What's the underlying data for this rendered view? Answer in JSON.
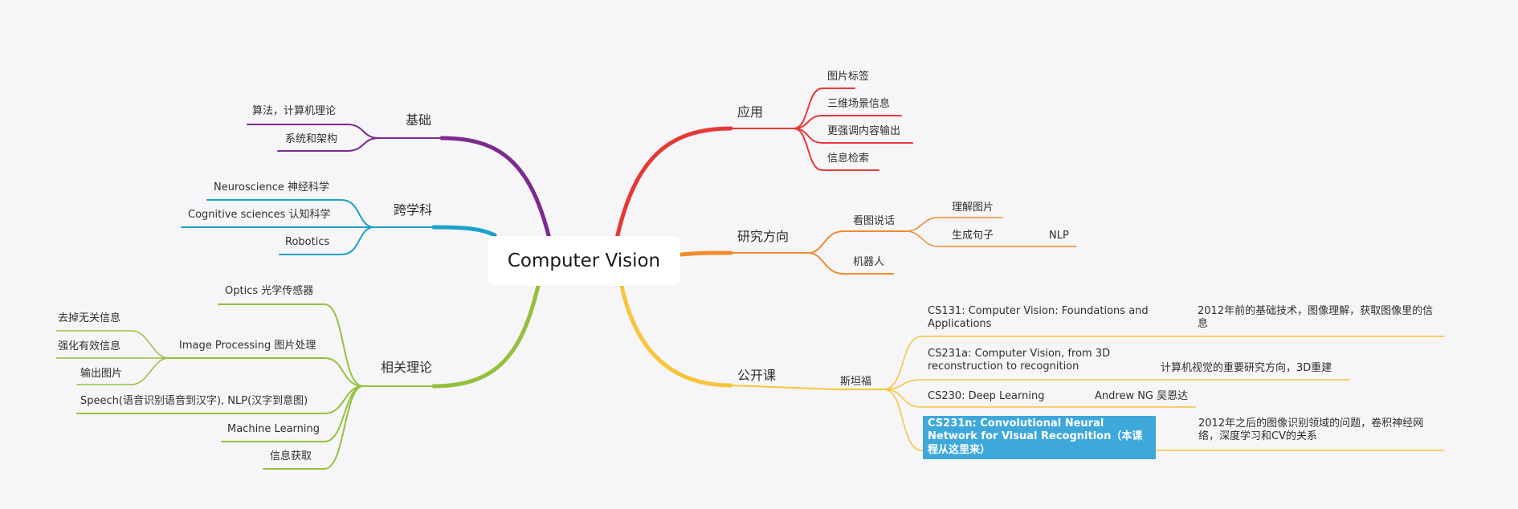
{
  "center": "Computer Vision",
  "colors": {
    "foundation": "#7b2a8e",
    "interdisciplinary": "#1aa3c8",
    "theory": "#93c13e",
    "applications": "#e53935",
    "research": "#f08c2c",
    "courses": "#f8c43a",
    "highlight": "#3ea8db"
  },
  "branches": {
    "foundation": {
      "label": "基础",
      "items": [
        "算法，计算机理论",
        "系统和架构"
      ]
    },
    "interdisciplinary": {
      "label": "跨学科",
      "items": [
        "Neuroscience 神经科学",
        "Cognitive sciences 认知科学",
        "Robotics"
      ]
    },
    "theory": {
      "label": "相关理论",
      "items": [
        "Optics 光学传感器",
        "Image Processing 图片处理",
        "Speech(语音识别语音到汉字), NLP(汉字到意图)",
        "Machine Learning",
        "信息获取"
      ],
      "image_processing_children": [
        "去掉无关信息",
        "强化有效信息",
        "输出图片"
      ]
    },
    "applications": {
      "label": "应用",
      "items": [
        "图片标签",
        "三维场景信息",
        "更强调内容输出",
        "信息检索"
      ]
    },
    "research": {
      "label": "研究方向",
      "captioning": "看图说话",
      "captioning_children": [
        "理解图片",
        "生成句子"
      ],
      "nlp": "NLP",
      "robot": "机器人"
    },
    "courses": {
      "label": "公开课",
      "stanford": "斯坦福",
      "cs131": "CS131: Computer Vision: Foundations and Applications",
      "cs131_note": "2012年前的基础技术，图像理解，获取图像里的信息",
      "cs231a": "CS231a: Computer Vision, from 3D reconstruction to recognition",
      "cs231a_note": "计算机视觉的重要研究方向，3D重建",
      "cs230": "CS230: Deep Learning",
      "cs230_note": "Andrew NG 吴恩达",
      "cs231n": "CS231n: Convolutional Neural Network for Visual Recognition（本课程从这里来）",
      "cs231n_note": "2012年之后的图像识别领域的问题，卷积神经网络，深度学习和CV的关系"
    }
  }
}
